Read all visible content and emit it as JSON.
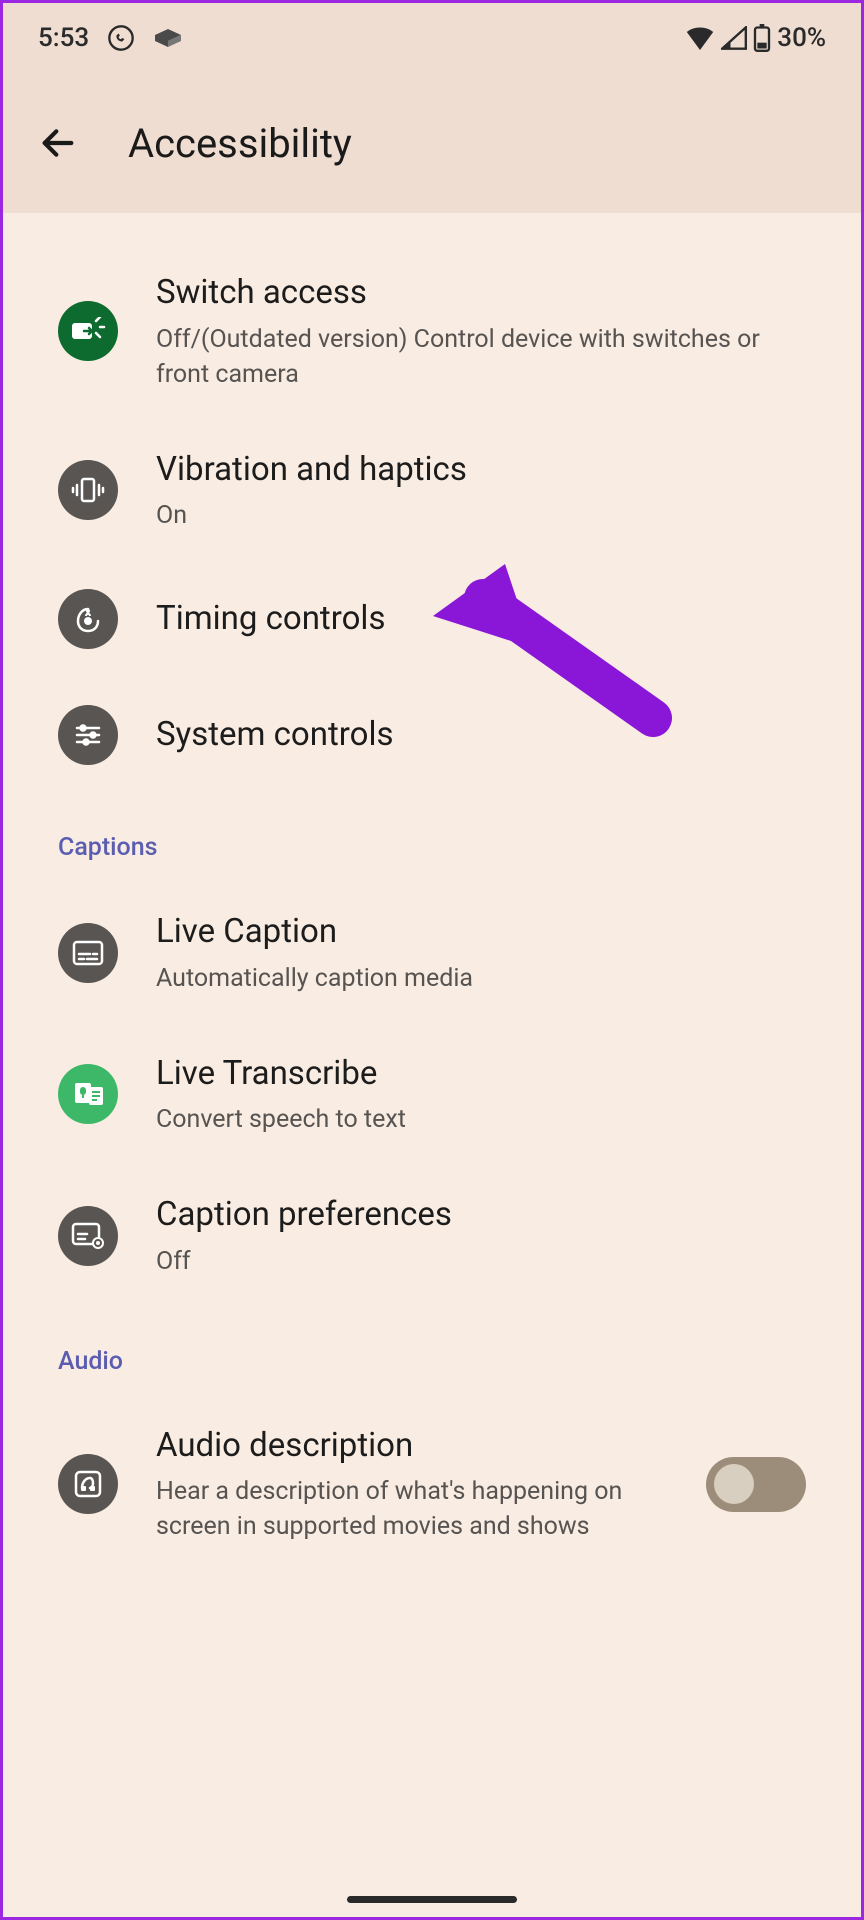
{
  "status_bar": {
    "time": "5:53",
    "battery": "30%"
  },
  "app_bar": {
    "title": "Accessibility"
  },
  "sections": {
    "interaction": [
      {
        "title": "Switch access",
        "subtitle": "Off/(Outdated version) Control device with switches or front camera"
      },
      {
        "title": "Vibration and haptics",
        "subtitle": "On"
      },
      {
        "title": "Timing controls"
      },
      {
        "title": "System controls"
      }
    ],
    "captions_header": "Captions",
    "captions": [
      {
        "title": "Live Caption",
        "subtitle": "Automatically caption media"
      },
      {
        "title": "Live Transcribe",
        "subtitle": "Convert speech to text"
      },
      {
        "title": "Caption preferences",
        "subtitle": "Off"
      }
    ],
    "audio_header": "Audio",
    "audio": [
      {
        "title": "Audio description",
        "subtitle": "Hear a description of what's happening on screen in supported movies and shows"
      }
    ]
  }
}
